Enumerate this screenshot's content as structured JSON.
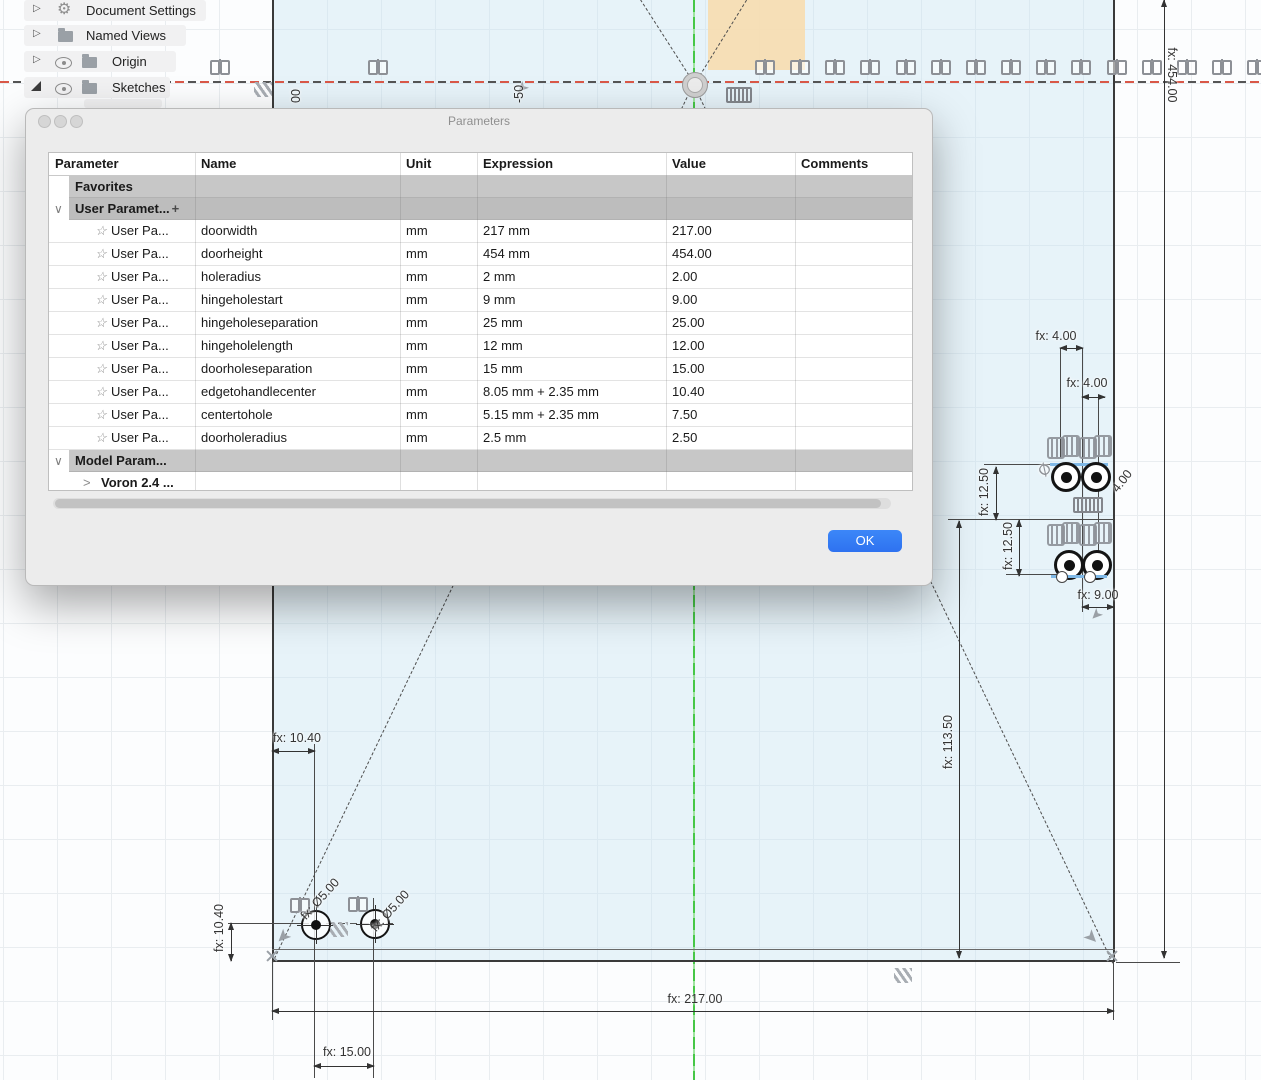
{
  "browser": {
    "items": [
      {
        "label": "Document Settings",
        "icon": "gear"
      },
      {
        "label": "Named Views",
        "icon": "folder"
      },
      {
        "label": "Origin",
        "icon": "folder"
      },
      {
        "label": "Sketches",
        "icon": "folder"
      }
    ]
  },
  "dialog": {
    "title": "Parameters",
    "columns": [
      "Parameter",
      "Name",
      "Unit",
      "Expression",
      "Value",
      "Comments"
    ],
    "favorites_label": "Favorites",
    "user_params_label": "User Paramet...",
    "model_params_label": "Model Param...",
    "model_child_label": "Voron 2.4 ...",
    "row_parameter_label": "User Pa...",
    "rows": [
      {
        "name": "doorwidth",
        "unit": "mm",
        "expression": "217 mm",
        "value": "217.00",
        "comments": ""
      },
      {
        "name": "doorheight",
        "unit": "mm",
        "expression": "454 mm",
        "value": "454.00",
        "comments": ""
      },
      {
        "name": "holeradius",
        "unit": "mm",
        "expression": "2 mm",
        "value": "2.00",
        "comments": ""
      },
      {
        "name": "hingeholestart",
        "unit": "mm",
        "expression": "9 mm",
        "value": "9.00",
        "comments": ""
      },
      {
        "name": "hingeholeseparation",
        "unit": "mm",
        "expression": "25 mm",
        "value": "25.00",
        "comments": ""
      },
      {
        "name": "hingeholelength",
        "unit": "mm",
        "expression": "12 mm",
        "value": "12.00",
        "comments": ""
      },
      {
        "name": "doorholeseparation",
        "unit": "mm",
        "expression": "15 mm",
        "value": "15.00",
        "comments": ""
      },
      {
        "name": "edgetohandlecenter",
        "unit": "mm",
        "expression": "8.05 mm + 2.35 mm",
        "value": "10.40",
        "comments": ""
      },
      {
        "name": "centertohole",
        "unit": "mm",
        "expression": "5.15 mm + 2.35 mm",
        "value": "7.50",
        "comments": ""
      },
      {
        "name": "doorholeradius",
        "unit": "mm",
        "expression": "2.5 mm",
        "value": "2.50",
        "comments": ""
      }
    ],
    "ok_label": "OK"
  },
  "canvas": {
    "dims": {
      "height": "fx: 454.00",
      "width": "fx: 217.00",
      "hinge_offset_a": "fx: 4.00",
      "hinge_offset_b": "fx: 4.00",
      "hinge_sep_a": "fx: 12.50",
      "hinge_sep_b": "fx: 12.50",
      "hinge_start": "fx: 9.00",
      "hinge_mid": "fx: 113.50",
      "handle_edge_top": "fx: 10.40",
      "handle_edge_left": "fx: 10.40",
      "handle_sep": "fx: 15.00",
      "handle_dia_a": "fx: Ø5.00",
      "handle_dia_b": "fx: Ø5.00",
      "hinge_dia_fragment": "4.00",
      "dia_symbol": "Ø",
      "label_fragment_left": "00",
      "label_fragment_mid": "-50"
    },
    "colors": {
      "axis_green": "#47c747",
      "construction_red": "#d95848",
      "door_fill": "#dcebf7",
      "slot_blue": "#7fb8e6",
      "ok_blue": "#2f7bf5"
    }
  },
  "icons": {
    "star": "☆",
    "chevron_down": "∨",
    "chevron_right": ">",
    "add": "+",
    "gear": "⚙",
    "expand_arrow": "▷",
    "marker_arrow": "➤"
  }
}
